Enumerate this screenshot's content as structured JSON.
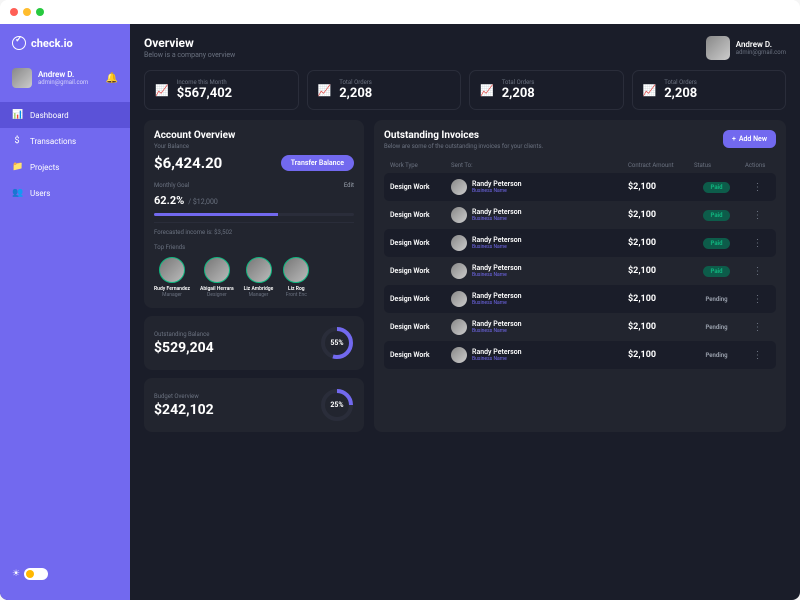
{
  "app_name": "check.io",
  "sidebar": {
    "user": {
      "name": "Andrew D.",
      "email": "admin@gmail.com"
    },
    "nav": [
      {
        "icon": "bar-icon",
        "label": "Dashboard"
      },
      {
        "icon": "dollar-icon",
        "label": "Transactions"
      },
      {
        "icon": "folder-icon",
        "label": "Projects"
      },
      {
        "icon": "users-icon",
        "label": "Users"
      }
    ]
  },
  "header": {
    "title": "Overview",
    "subtitle": "Below is a company overview",
    "user": {
      "name": "Andrew D.",
      "email": "admin@gmail.com"
    }
  },
  "stats": [
    {
      "label": "Income this Month",
      "value": "$567,402"
    },
    {
      "label": "Total Orders",
      "value": "2,208"
    },
    {
      "label": "Total Orders",
      "value": "2,208"
    },
    {
      "label": "Total Orders",
      "value": "2,208"
    }
  ],
  "account": {
    "title": "Account Overview",
    "balance_label": "Your Balance",
    "balance": "$6,424.20",
    "transfer_btn": "Transfer Balance",
    "goal_label": "Monthly Goal",
    "goal_percent": "62.2%",
    "goal_total": "$12,000",
    "edit": "Edit",
    "forecast_label": "Forecasted income is:",
    "forecast": "$3,502",
    "friends_label": "Top Friends",
    "friends": [
      {
        "name": "Rudy Fernandez",
        "role": "Manager"
      },
      {
        "name": "Abigail Herrara",
        "role": "Designer"
      },
      {
        "name": "Liz Ambridge",
        "role": "Manager"
      },
      {
        "name": "Liz Rog",
        "role": "Front Enc"
      }
    ]
  },
  "outstanding": {
    "label": "Outstanding Balance",
    "value": "$529,204",
    "percent": "55%"
  },
  "budget": {
    "label": "Budget Overview",
    "value": "$242,102",
    "percent": "25%"
  },
  "invoices": {
    "title": "Outstanding Invoices",
    "subtitle": "Below are some of the outstanding invoices for your clients.",
    "add_btn": "Add New",
    "cols": {
      "work": "Work Type",
      "sent": "Sent To:",
      "amount": "Contract Amount",
      "status": "Status",
      "actions": "Actions"
    },
    "rows": [
      {
        "work": "Design Work",
        "name": "Randy Peterson",
        "biz": "Business Name",
        "amount": "$2,100",
        "status": "Paid"
      },
      {
        "work": "Design Work",
        "name": "Randy Peterson",
        "biz": "Business Name",
        "amount": "$2,100",
        "status": "Paid"
      },
      {
        "work": "Design Work",
        "name": "Randy Peterson",
        "biz": "Business Name",
        "amount": "$2,100",
        "status": "Paid"
      },
      {
        "work": "Design Work",
        "name": "Randy Peterson",
        "biz": "Business Name",
        "amount": "$2,100",
        "status": "Paid"
      },
      {
        "work": "Design Work",
        "name": "Randy Peterson",
        "biz": "Business Name",
        "amount": "$2,100",
        "status": "Pending"
      },
      {
        "work": "Design Work",
        "name": "Randy Peterson",
        "biz": "Business Name",
        "amount": "$2,100",
        "status": "Pending"
      },
      {
        "work": "Design Work",
        "name": "Randy Peterson",
        "biz": "Business Name",
        "amount": "$2,100",
        "status": "Pending"
      }
    ]
  }
}
